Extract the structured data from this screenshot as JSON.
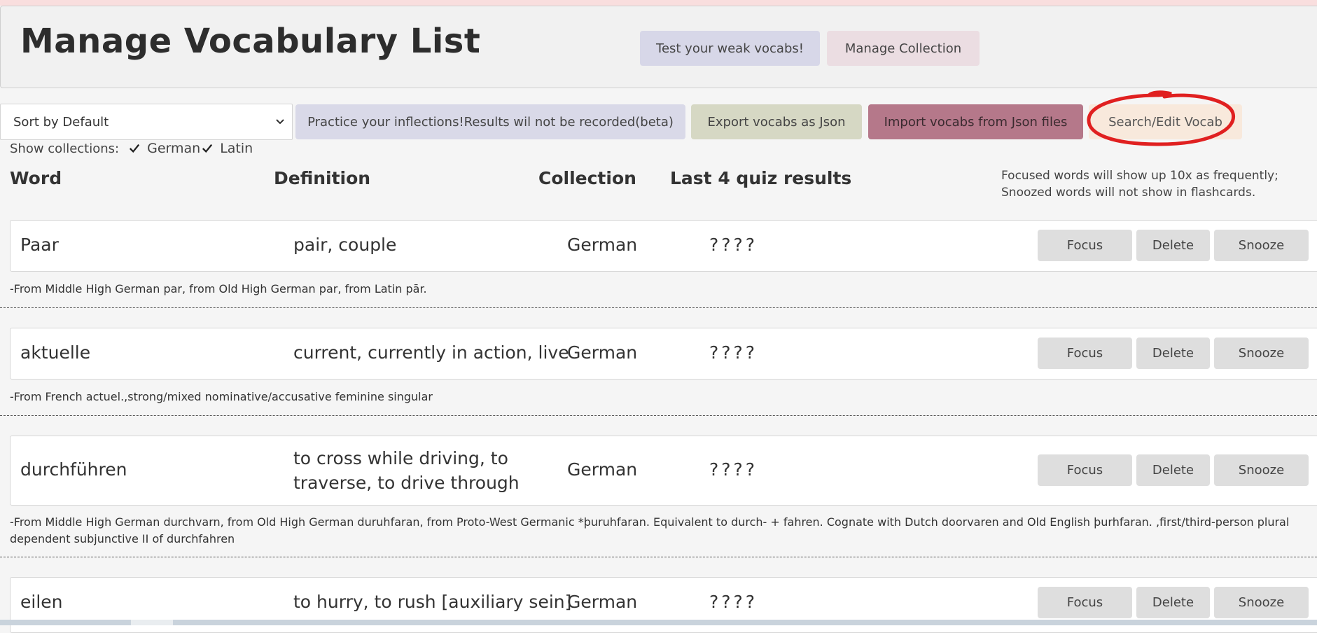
{
  "page": {
    "title": "Manage Vocabulary List",
    "test_weak_label": "Test your weak vocabs!",
    "manage_collection_label": "Manage Collection"
  },
  "toolbar": {
    "sort_value": "Sort by Default",
    "practice_label": "Practice your inflections!Results wil not be recorded(beta)",
    "export_label": "Export vocabs as Json",
    "import_label": "Import vocabs from Json files",
    "search_label": "Search/Edit Vocab"
  },
  "filters": {
    "label": "Show collections:",
    "collections": [
      {
        "name": "German",
        "checked": true
      },
      {
        "name": "Latin",
        "checked": true
      }
    ]
  },
  "columns": {
    "word": "Word",
    "definition": "Definition",
    "collection": "Collection",
    "last_results": "Last 4 quiz results",
    "note": "Focused words will show up 10x as frequently; Snoozed words will not show in flashcards."
  },
  "actions": {
    "focus": "Focus",
    "delete": "Delete",
    "snooze": "Snooze"
  },
  "vocab": [
    {
      "word": "Paar",
      "definition": "pair, couple",
      "collection": "German",
      "results": "????",
      "etymology": "-From Middle High German par, from Old High German par, from Latin pār."
    },
    {
      "word": "aktuelle",
      "definition": "current, currently in action, live",
      "collection": "German",
      "results": "????",
      "etymology": "-From French actuel.,strong/mixed nominative/accusative feminine singular"
    },
    {
      "word": "durchführen",
      "definition": "to cross while driving, to traverse, to drive through",
      "collection": "German",
      "results": "????",
      "etymology": "-From Middle High German durchvarn, from Old High German duruhfaran, from Proto-West Germanic *þuruhfaran. Equivalent to durch- + fahren. Cognate with Dutch doorvaren and Old English þurhfaran. ,first/third-person plural dependent subjunctive II of durchfahren"
    },
    {
      "word": "eilen",
      "definition": "to hurry, to rush [auxiliary sein]",
      "collection": "German",
      "results": "????"
    }
  ],
  "annotation": {
    "color": "#e02020"
  }
}
